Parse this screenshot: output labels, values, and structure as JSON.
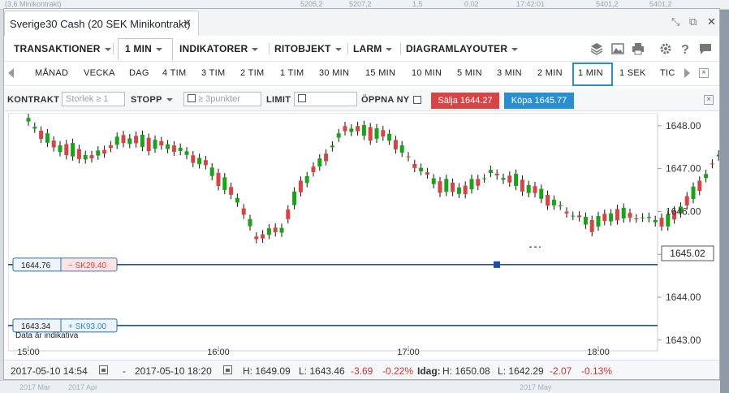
{
  "background": {
    "top_texts": [
      "(3,6 Minikontrakt)",
      "5205,2",
      "5207,2",
      "1,5",
      "0,02",
      "17:42:01",
      "5401,2",
      "5401,2"
    ],
    "bottom_texts": [
      "2017 Mar",
      "2017 Apr",
      "2017 May"
    ]
  },
  "window": {
    "title": "Sverige30 Cash (20 SEK Minikontrakt)",
    "close_glyph": "✕"
  },
  "toolbar1": {
    "menus": [
      {
        "label": "TRANSAKTIONER",
        "dropdown": true
      },
      {
        "label": "1 MIN",
        "dropdown": true,
        "selected": true
      },
      {
        "label": "INDIKATORER",
        "dropdown": true
      },
      {
        "label": "RITOBJEKT",
        "dropdown": true
      },
      {
        "label": "LARM",
        "dropdown": true
      },
      {
        "label": "DIAGRAMLAYOUTER",
        "dropdown": true
      }
    ],
    "icons": [
      "layers-icon",
      "image-icon",
      "print-icon",
      "gear-icon",
      "help-icon",
      "comment-icon"
    ]
  },
  "toolbar2": {
    "periods": [
      "MÅNAD",
      "VECKA",
      "DAG",
      "4 TIM",
      "3 TIM",
      "2 TIM",
      "1 TIM",
      "30 MIN",
      "15 MIN",
      "10 MIN",
      "5 MIN",
      "3 MIN",
      "2 MIN",
      "1 MIN",
      "1 SEK",
      "TIC"
    ],
    "active": "1 MIN"
  },
  "toolbar3": {
    "kontrakt_label": "KONTRAKT",
    "size_placeholder": "Storlek ≥ 1",
    "stopp_label": "STOPP",
    "points_placeholder": "≥ 3punkter",
    "limit_label": "LIMIT",
    "open_new_label": "ÖPPNA NY",
    "sell_label": "Sälja 1644.27",
    "buy_label": "Köpa 1645.77"
  },
  "chart": {
    "watermark": "Data är indikativa",
    "current_price_label": "1645.02",
    "position_lines": [
      {
        "price_label": "1644.76",
        "pnl_label": "− SK29.40",
        "pnl_color": "#d64545"
      },
      {
        "price_label": "1643.34",
        "pnl_label": "+ SK93.00",
        "pnl_color": "#2a8fd0"
      }
    ]
  },
  "chart_data": {
    "type": "candlestick",
    "x_ticks": [
      "15:00",
      "16:00",
      "17:00",
      "18:00"
    ],
    "y_ticks": [
      "1643.00",
      "1644.00",
      "1645.00",
      "1646.00",
      "1647.00",
      "1648.00"
    ],
    "ylim": [
      1642.75,
      1648.3
    ],
    "current_price": 1645.02,
    "position_prices": [
      1644.76,
      1643.34
    ],
    "up_color": "#1aa31a",
    "down_color": "#d64545",
    "position_line_color": "#0b3d7a",
    "grid": false,
    "candles": []
  },
  "statusbar": {
    "from": "2017-05-10 14:54",
    "dash": "-",
    "to": "2017-05-10 18:20",
    "high": "H: 1649.09",
    "low": "L: 1643.46",
    "change": "-3.69",
    "change_pct": "-0.22%",
    "today_label": "Idag:",
    "today_high": "H: 1650.08",
    "today_low": "L: 1642.29",
    "today_change": "-2.07",
    "today_change_pct": "-0.13%"
  }
}
